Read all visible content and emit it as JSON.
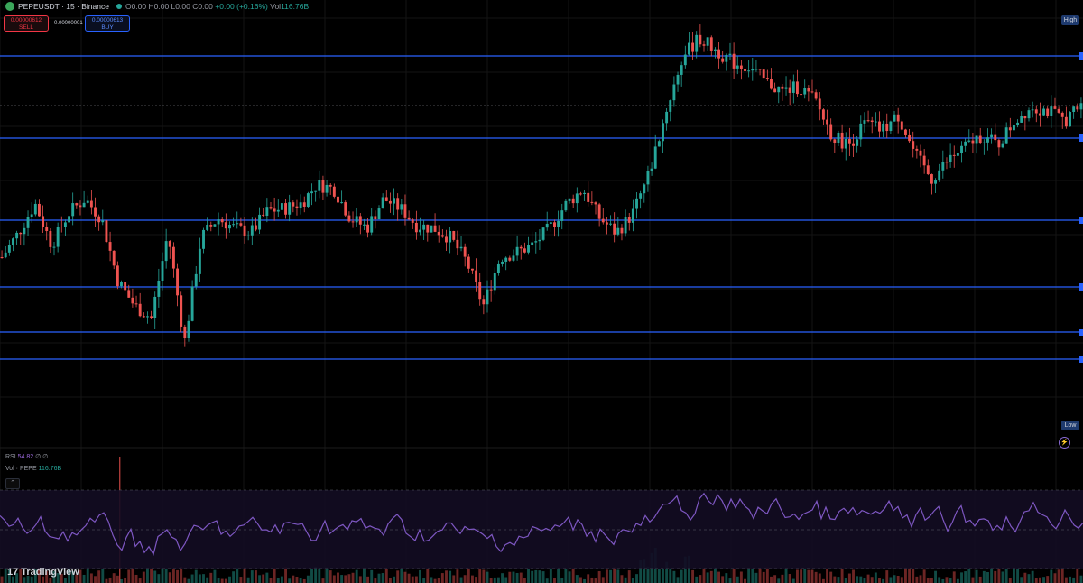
{
  "header": {
    "symbol": "PEPEUSDT",
    "interval": "15",
    "exchange": "Binance",
    "title": "PEPEUSDT · 15 · Binance",
    "ohlc_open": "O0.00",
    "ohlc_high": "H0.00",
    "ohlc_low": "L0.00",
    "ohlc_close": "C0.00",
    "change": "+0.00 (+0.16%)",
    "vol_label": "Vol",
    "vol_value": "116.76B"
  },
  "trade": {
    "sell_price": "0.00000612",
    "sell_label": "SELL",
    "spread": "0.00000001",
    "buy_price": "0.00000613",
    "buy_label": "BUY"
  },
  "price_scale": {
    "high_label": "High",
    "low_label": "Low"
  },
  "indicators": {
    "rsi_label": "RSI",
    "rsi_value": "54.82",
    "rsi_extra": "∅ ∅",
    "vol_label": "Vol · PEPE",
    "vol_value": "116.76B",
    "collapse_icon": "chevron-up-icon"
  },
  "branding": {
    "logo_text": "TradingView",
    "logo_mark": "17"
  },
  "colors": {
    "background": "#000000",
    "up_candle": "#26a69a",
    "down_candle": "#ef5350",
    "hline": "#2962ff",
    "rsi_line": "#7e57c2",
    "rsi_band": "#1a1030"
  },
  "chart_data": {
    "type": "candlestick",
    "symbol": "PEPEUSDT",
    "timeframe": "15",
    "price_close_path": [
      0.5,
      0.6,
      0.72,
      0.55,
      0.68,
      0.74,
      0.66,
      0.4,
      0.3,
      0.25,
      0.6,
      0.15,
      0.58,
      0.66,
      0.62,
      0.6,
      0.69,
      0.7,
      0.72,
      0.8,
      0.78,
      0.66,
      0.62,
      0.74,
      0.7,
      0.63,
      0.62,
      0.58,
      0.48,
      0.3,
      0.5,
      0.52,
      0.55,
      0.62,
      0.72,
      0.78,
      0.66,
      0.6,
      0.68,
      0.85,
      1.1,
      1.32,
      1.4,
      1.35,
      1.3,
      1.28,
      1.22,
      1.18,
      1.2,
      1.14,
      1.0,
      0.96,
      1.05,
      1.02,
      1.08,
      0.92,
      0.82,
      0.9,
      0.95,
      1.0,
      0.96,
      1.06,
      1.12,
      1.1,
      1.06,
      1.12
    ],
    "horizontal_levels_note": "6 horizontal blue support/resistance lines",
    "rsi_value": 54.82,
    "rsi_levels": [
      70,
      50,
      30
    ],
    "volume_last": "116.76B"
  }
}
